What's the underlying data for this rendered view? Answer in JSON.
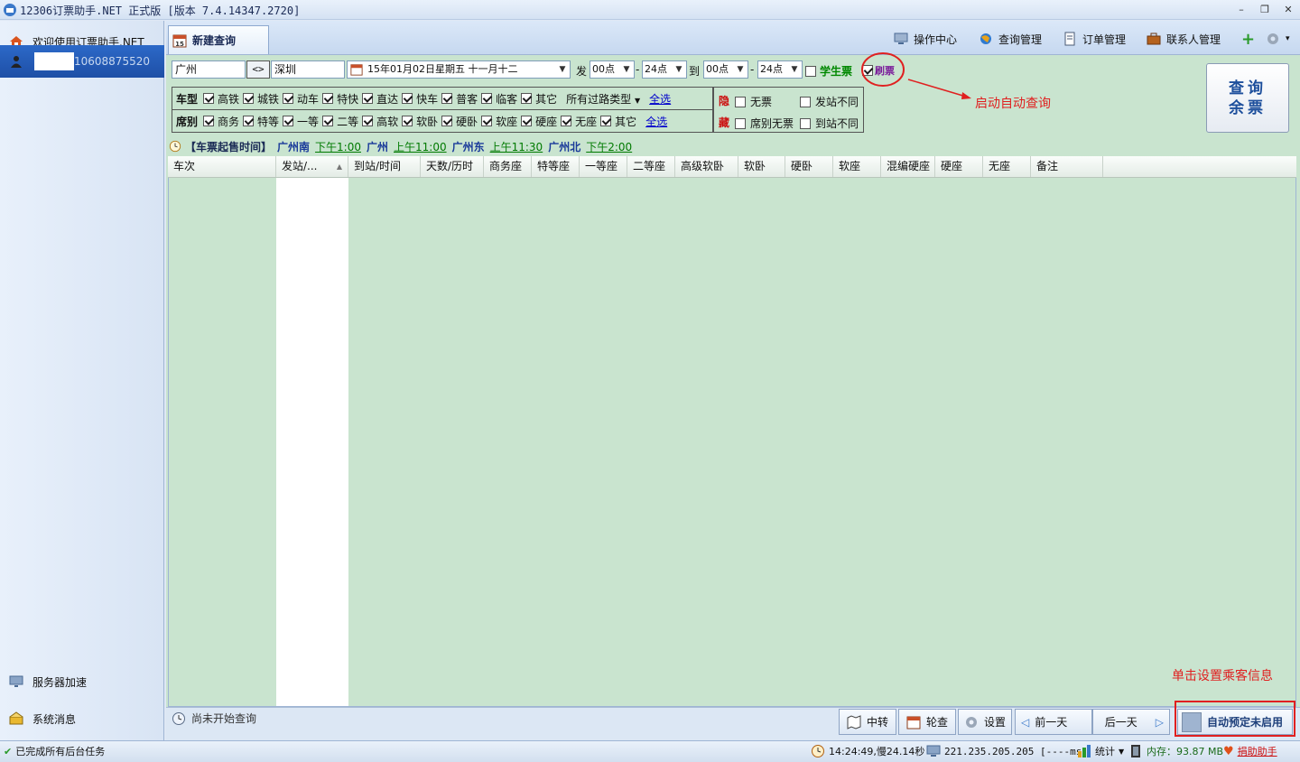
{
  "window": {
    "title": "12306订票助手.NET   正式版 [版本 7.4.14347.2720]",
    "min": "–",
    "max": "❐",
    "close": "✕"
  },
  "sidebar": {
    "welcome": "欢迎使用订票助手.NET",
    "user_id": "10608875520",
    "server_boost": "服务器加速",
    "system_message": "系统消息"
  },
  "tab": {
    "label": "新建查询",
    "calendar_day": "15"
  },
  "topnav": {
    "operation_center": "操作中心",
    "query_manage": "查询管理",
    "order_manage": "订单管理",
    "contacts_manage": "联系人管理",
    "add": "+",
    "settings_caret": "▾"
  },
  "search": {
    "from": "广州",
    "swap": "<>",
    "to": "深圳",
    "date_text": "15年01月02日星期五  十一月十二",
    "depart_label": "发",
    "depart_from": "00点",
    "depart_to": "24点",
    "arrive_label": "到",
    "arrive_from": "00点",
    "arrive_to": "24点",
    "dash": "-",
    "student_ticket": "学生票",
    "auto_query_label": "刷票"
  },
  "train_types": {
    "label": "车型",
    "options": [
      "高铁",
      "城铁",
      "动车",
      "特快",
      "直达",
      "快车",
      "普客",
      "临客",
      "其它"
    ],
    "pass_type": "所有过路类型",
    "select_all": "全选"
  },
  "seat_types": {
    "label": "席别",
    "options": [
      "商务",
      "特等",
      "一等",
      "二等",
      "高软",
      "软卧",
      "硬卧",
      "软座",
      "硬座",
      "无座",
      "其它"
    ],
    "select_all": "全选"
  },
  "hide_options": {
    "hide_label": "隐",
    "ticket_label": "藏",
    "no_ticket": "无票",
    "diff_depart": "发站不同",
    "seat_no_ticket": "席别无票",
    "diff_arrive": "到站不同"
  },
  "sale_times": {
    "prefix": "【车票起售时间】",
    "stations": [
      {
        "name": "广州南",
        "time": "下午1:00"
      },
      {
        "name": "广州",
        "time": "上午11:00"
      },
      {
        "name": "广州东",
        "time": "上午11:30"
      },
      {
        "name": "广州北",
        "time": "下午2:00"
      }
    ]
  },
  "annotations": {
    "auto_query": "启动自动查询",
    "set_passenger": "单击设置乘客信息"
  },
  "query_button": {
    "line1": "查询",
    "line2": "余票"
  },
  "table": {
    "columns": [
      "车次",
      "发站/...",
      "到站/时间",
      "天数/历时",
      "商务座",
      "特等座",
      "一等座",
      "二等座",
      "高级软卧",
      "软卧",
      "硬卧",
      "软座",
      "混编硬座",
      "硬座",
      "无座",
      "备注"
    ],
    "sort_indicator": "▲"
  },
  "bottom": {
    "status": "尚未开始查询",
    "transfer": "中转",
    "rotate": "轮查",
    "settings": "设置",
    "prev_day": "前一天",
    "next_day": "后一天",
    "auto_book": "自动预定未启用"
  },
  "statusbar": {
    "tasks": "已完成所有后台任务",
    "time": "14:24:49,慢24.14秒",
    "server": "221.235.205.205 [----ms]",
    "stats": "统计",
    "memory": "内存：93.87 MB",
    "donate": "捐助助手"
  },
  "colors": {
    "grid_bg": "#c9e4cf",
    "annotation": "#e02020",
    "link_blue": "#0000cc",
    "station_green": "#007a00"
  }
}
